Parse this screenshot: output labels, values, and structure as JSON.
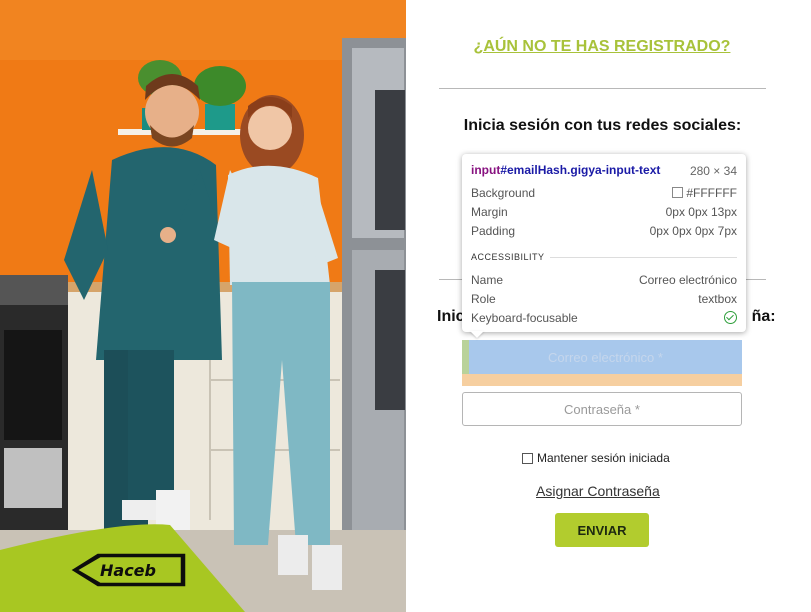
{
  "colors": {
    "accent": "#a8c23a",
    "button": "#b2cc2e",
    "hero_bg": "#f07a15"
  },
  "brand": {
    "logo_text": "Haceb"
  },
  "header": {
    "register_link": "¿AÚN NO TE HAS REGISTRADO?"
  },
  "social": {
    "heading": "Inicia sesión con tus redes sociales:"
  },
  "login": {
    "heading": "Inic",
    "heading_tail": "ña:",
    "email_placeholder": "Correo electrónico *",
    "password_placeholder": "Contraseña *",
    "remember_label": "Mantener sesión iniciada",
    "assign_link": "Asignar Contraseña",
    "submit_label": "ENVIAR"
  },
  "inspector": {
    "selector_tag": "input",
    "selector_rest": "#emailHash.gigya-input-text",
    "dimensions": "280 × 34",
    "background_label": "Background",
    "background_value": "#FFFFFF",
    "margin_label": "Margin",
    "margin_value": "0px 0px 13px",
    "padding_label": "Padding",
    "padding_value": "0px 0px 0px 7px",
    "section": "ACCESSIBILITY",
    "name_label": "Name",
    "name_value": "Correo electrónico",
    "role_label": "Role",
    "role_value": "textbox",
    "focus_label": "Keyboard-focusable",
    "focus_icon": "check-circle-icon"
  }
}
